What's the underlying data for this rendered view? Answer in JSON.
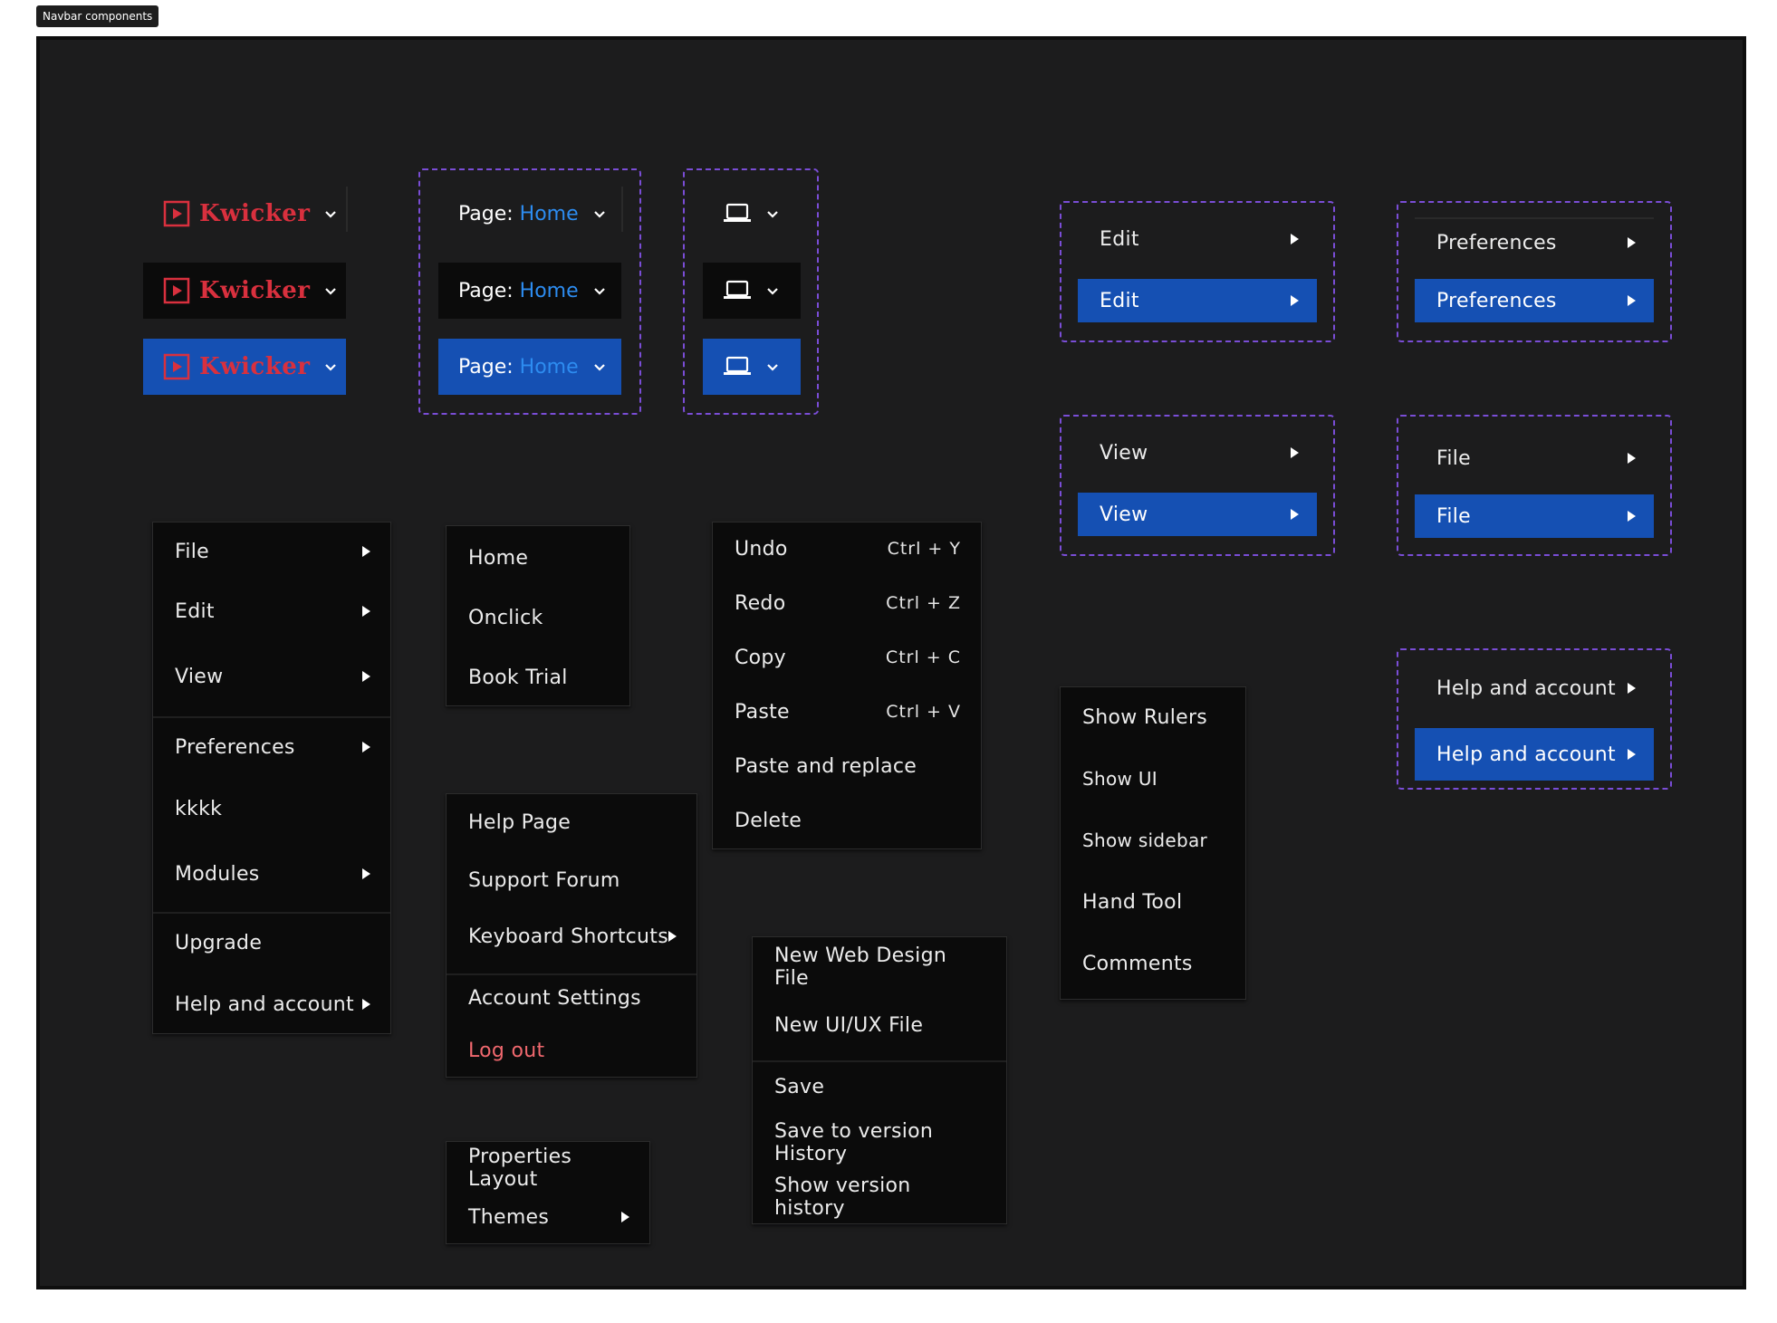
{
  "frame_label": "Navbar components",
  "brand": {
    "name": "Kwicker"
  },
  "page_selector": {
    "prefix": "Page:",
    "value": "Home"
  },
  "edit_label": "Edit",
  "view_label": "View",
  "preferences_label": "Preferences",
  "file_label": "File",
  "help_label": "Help and account",
  "main_menu": {
    "items": [
      "File",
      "Edit",
      "View",
      "Preferences",
      "kkkk",
      "Modules",
      "Upgrade",
      "Help and account"
    ]
  },
  "pages_menu": {
    "items": [
      "Home",
      "Onclick",
      "Book Trial"
    ]
  },
  "help_menu": {
    "items": [
      "Help Page",
      "Support Forum",
      "Keyboard Shortcuts",
      "Account Settings",
      "Log out"
    ]
  },
  "prefs_menu": {
    "items": [
      "Properties Layout",
      "Themes"
    ]
  },
  "edit_menu": {
    "items": [
      {
        "label": "Undo",
        "shortcut": "Ctrl + Y"
      },
      {
        "label": "Redo",
        "shortcut": "Ctrl + Z"
      },
      {
        "label": "Copy",
        "shortcut": "Ctrl + C"
      },
      {
        "label": "Paste",
        "shortcut": "Ctrl + V"
      },
      {
        "label": "Paste and replace",
        "shortcut": ""
      },
      {
        "label": "Delete",
        "shortcut": ""
      }
    ]
  },
  "file_menu": {
    "items": [
      "New Web Design File",
      "New UI/UX File",
      "Save",
      "Save to version History",
      "Show version history"
    ]
  },
  "view_menu": {
    "items": [
      "Show Rulers",
      "Show UI",
      "Show sidebar",
      "Hand Tool",
      "Comments"
    ]
  },
  "colors": {
    "frame_bg": "#1c1c1d",
    "menu_bg": "#0b0b0b",
    "highlight": "#1550b3",
    "brand_red": "#d9303e",
    "link_blue": "#2d8cf0",
    "dash_purple": "#7a4dd6",
    "danger": "#f0686e"
  }
}
